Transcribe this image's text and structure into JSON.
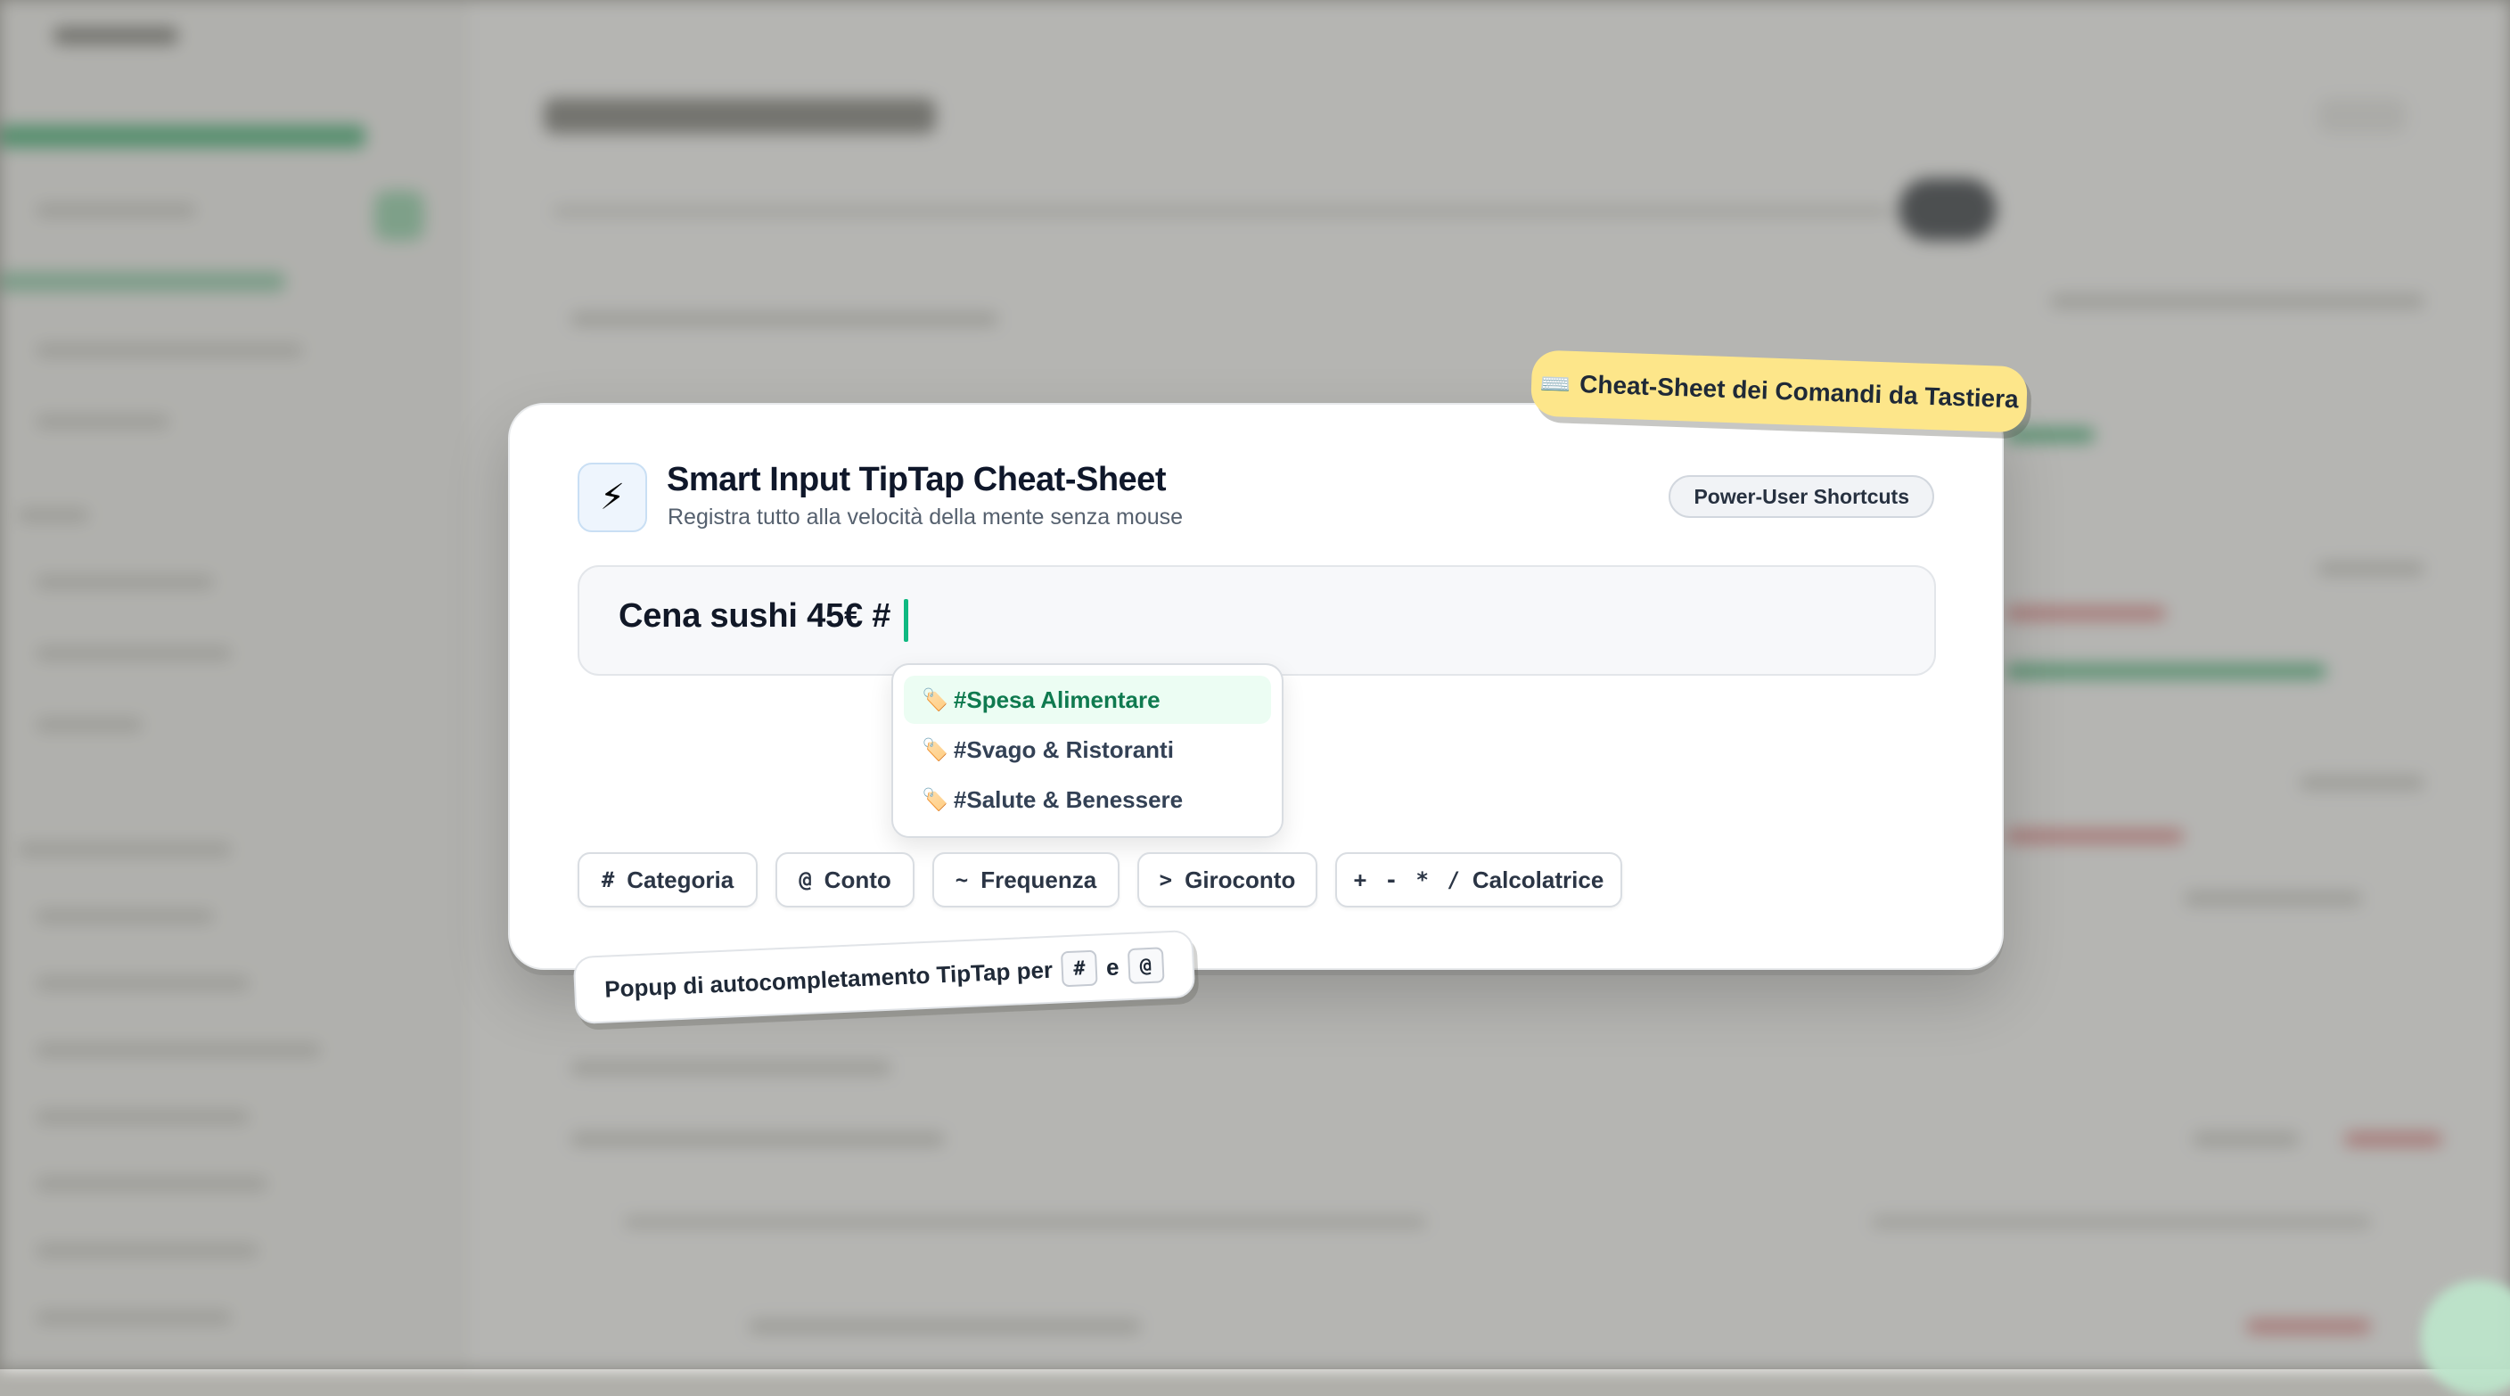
{
  "cheatsheet_label": {
    "icon": "keyboard-icon",
    "icon_glyph": "⌨️",
    "text": "Cheat-Sheet dei Comandi da Tastiera"
  },
  "card": {
    "icon": "lightning-bolt-icon",
    "icon_glyph": "⚡",
    "title": "Smart Input TipTap Cheat-Sheet",
    "subtitle": "Registra tutto alla velocità della mente senza mouse",
    "badge": "Power-User Shortcuts"
  },
  "editor": {
    "value": "Cena sushi 45€ #",
    "caret_color": "#10b981"
  },
  "autocomplete": {
    "items": [
      {
        "icon": "tag-icon",
        "icon_glyph": "🏷️",
        "label": "#Spesa Alimentare",
        "active": true
      },
      {
        "icon": "tag-icon",
        "icon_glyph": "🏷️",
        "label": "#Svago & Ristoranti",
        "active": false
      },
      {
        "icon": "tag-icon",
        "icon_glyph": "🏷️",
        "label": "#Salute & Benessere",
        "active": false
      }
    ],
    "active_color": "#0f7a4f"
  },
  "shortcuts": [
    {
      "symbol": "#",
      "label": "Categoria"
    },
    {
      "symbol": "@",
      "label": "Conto"
    },
    {
      "symbol": "~",
      "label": "Frequenza"
    },
    {
      "symbol": ">",
      "label": "Giroconto"
    },
    {
      "symbol": "+ - * /",
      "label": "Calcolatrice"
    }
  ],
  "caption": {
    "text": "Popup di autocompletamento TipTap per",
    "key1": "#",
    "joiner": "e",
    "key2": "@"
  },
  "colors": {
    "accent_green": "#10b981",
    "sticky_yellow": "#fde68a"
  }
}
